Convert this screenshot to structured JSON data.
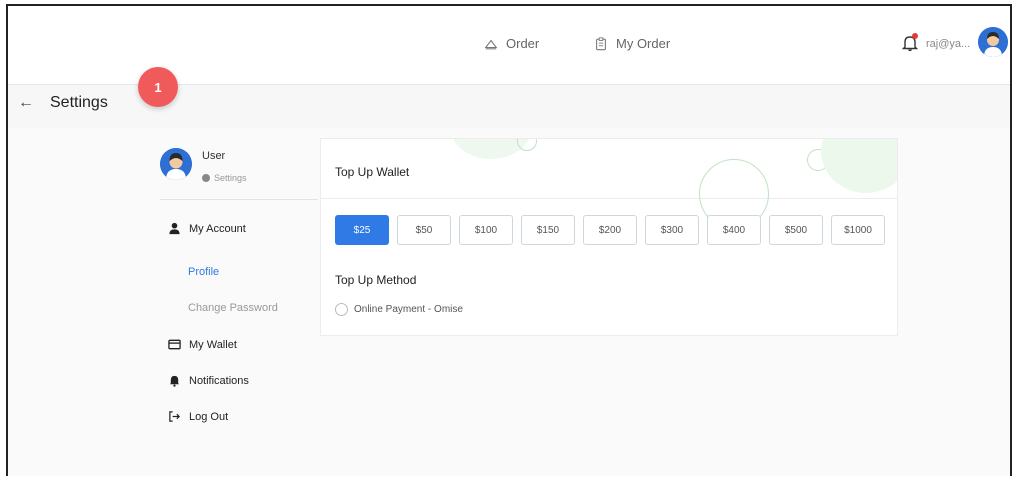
{
  "topbar": {
    "nav": [
      {
        "label": "Order",
        "icon": "home-icon"
      },
      {
        "label": "My Order",
        "icon": "clipboard-icon"
      }
    ],
    "user_email": "raj@ya..."
  },
  "settings": {
    "title": "Settings",
    "step_badge": "1"
  },
  "sidebar": {
    "user_name": "User",
    "user_sub": "Settings",
    "items": [
      {
        "label": "My Account",
        "icon": "user-icon"
      },
      {
        "label": "Profile"
      },
      {
        "label": "Change Password"
      },
      {
        "label": "My Wallet",
        "icon": "wallet-icon"
      },
      {
        "label": "Notifications",
        "icon": "bell-icon"
      },
      {
        "label": "Log Out",
        "icon": "logout-icon"
      }
    ]
  },
  "wallet": {
    "title": "Top Up Wallet",
    "amounts": [
      "$25",
      "$50",
      "$100",
      "$150",
      "$200",
      "$300",
      "$400",
      "$500",
      "$1000"
    ],
    "selected_amount": "$25",
    "method_title": "Top Up Method",
    "method_option": "Online Payment - Omise"
  },
  "colors": {
    "accent": "#2f7ae5",
    "badge": "#f05a5a",
    "notification_dot": "#e53935"
  }
}
